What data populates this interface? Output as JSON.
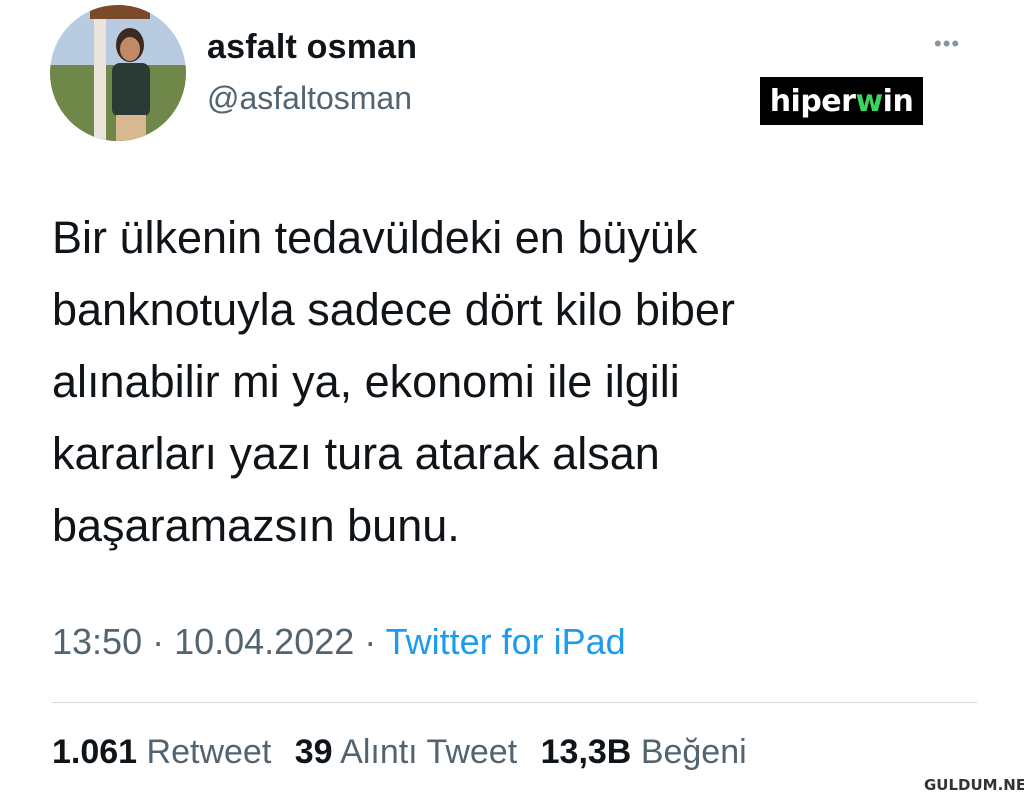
{
  "tweet": {
    "display_name": "asfalt osman",
    "handle": "@asfaltosman",
    "more_label": "•••",
    "text": "Bir ülkenin tedavüldeki en büyük\nbanknotuyla sadece dört kilo biber\nalınabilir mi ya, ekonomi ile ilgili\nkararları yazı tura atarak alsan\nbaşaramazsın bunu.",
    "time": "13:50",
    "date": "10.04.2022",
    "separator": " · ",
    "source": "Twitter for iPad"
  },
  "stats": {
    "retweets_count": "1.061",
    "retweets_label": "Retweet",
    "quotes_count": "39",
    "quotes_label": "Alıntı Tweet",
    "likes_count": "13,3B",
    "likes_label": "Beğeni"
  },
  "watermark": {
    "text_a": "hiper",
    "text_b": "w",
    "text_c": "in"
  },
  "site_watermark": "GULDUM.NET",
  "colors": {
    "text_primary": "#0f1419",
    "text_secondary": "#536471",
    "link": "#1d9bf0",
    "watermark_bg": "#000000",
    "watermark_accent": "#3cd45a"
  }
}
